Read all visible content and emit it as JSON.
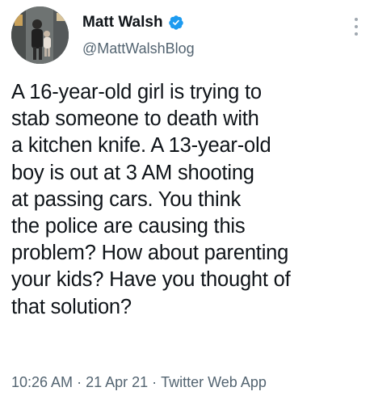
{
  "author": {
    "display_name": "Matt Walsh",
    "handle": "@MattWalshBlog",
    "verified": true
  },
  "tweet": {
    "text": "A 16-year-old girl is trying to\nstab someone to death with\na kitchen knife. A 13-year-old\nboy is out at 3 AM shooting\nat passing cars. You think\nthe police are causing this\nproblem? How about parenting\nyour kids? Have you thought of\nthat solution?",
    "time": "10:26 AM",
    "date": "21 Apr 21",
    "separator": "·",
    "source_app": "Twitter Web App"
  },
  "icons": {
    "verified": "verified-badge-icon",
    "more": "more-options-icon"
  },
  "colors": {
    "verified_blue": "#1d9bf0",
    "secondary_text": "#536471",
    "primary_text": "#0f1419"
  }
}
